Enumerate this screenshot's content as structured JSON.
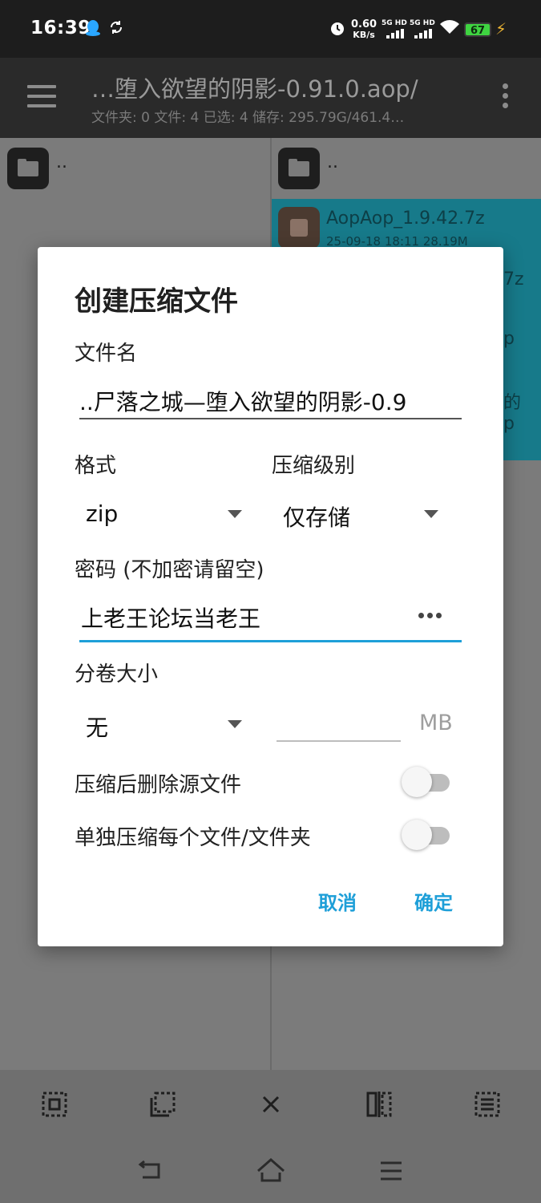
{
  "status_bar": {
    "time": "16:39",
    "speed_value": "0.60",
    "speed_unit": "KB/s",
    "net1": "5G HD",
    "net2": "5G HD",
    "battery": "67",
    "icons": [
      "qq-icon",
      "sync-icon",
      "alarm-icon",
      "wifi-icon",
      "charging-bolt-icon"
    ]
  },
  "app_bar": {
    "title": "…堕入欲望的阴影-0.91.0.aop/",
    "subtitle": "文件夹: 0  文件: 4  已选: 4  储存: 295.79G/461.4…"
  },
  "left_pane": {
    "up_label": ".."
  },
  "right_pane": {
    "up_label": "..",
    "selected_file": {
      "name": "AopAop_1.9.42.7z",
      "meta": "25-09-18 18:11  28.19M"
    },
    "peek_texts": [
      "7z",
      "p",
      "的",
      "p"
    ]
  },
  "dialog": {
    "title": "创建压缩文件",
    "filename_label": "文件名",
    "filename_value": "..尸落之城—堕入欲望的阴影-0.9",
    "format_label": "格式",
    "format_value": "zip",
    "level_label": "压缩级别",
    "level_value": "仅存储",
    "password_label": "密码 (不加密请留空)",
    "password_value": "上老王论坛当老王",
    "volume_label": "分卷大小",
    "volume_value": "无",
    "volume_size_value": "",
    "volume_unit": "MB",
    "delete_source_label": "压缩后删除源文件",
    "delete_source_on": false,
    "separate_label": "单独压缩每个文件/文件夹",
    "separate_on": false,
    "cancel_label": "取消",
    "ok_label": "确定"
  },
  "colors": {
    "accent": "#1e9fd8",
    "selection": "#177a8a",
    "dialog_bg": "#ffffff"
  },
  "bottom_toolbar": [
    "select-all-icon",
    "select-partial-icon",
    "close-icon",
    "invert-selection-icon",
    "list-select-icon"
  ],
  "nav_bar": [
    "back-icon",
    "home-icon",
    "menu-icon"
  ]
}
